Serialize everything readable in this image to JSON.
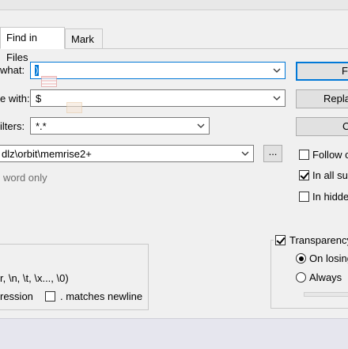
{
  "tabs": {
    "find_in_files": "Find in Files",
    "mark": "Mark"
  },
  "fields": {
    "find_label": "what:",
    "find_value": ")",
    "replace_label": "e with:",
    "replace_value": "$",
    "filters_label": "ilters:",
    "filters_value": "*.*",
    "directory_value": "dlz\\orbit\\memrise2+",
    "browse_label": "..."
  },
  "options": {
    "whole_word": "word only",
    "escape_chars": "r, \\n, \\t, \\x..., \\0)",
    "regex_label": "ression",
    "matches_newline": ". matches newline"
  },
  "right_buttons": {
    "find_all": "F",
    "replace": "Repla",
    "third": "C"
  },
  "right_checks": {
    "follow_doc": "Follow c",
    "in_all_sub": "In all su",
    "in_hidden": "In hidde"
  },
  "transparency": {
    "label": "Transparency",
    "on_losing": "On losing",
    "always": "Always"
  },
  "colors": {
    "accent": "#0078d7",
    "background": "#f0f0f0"
  }
}
